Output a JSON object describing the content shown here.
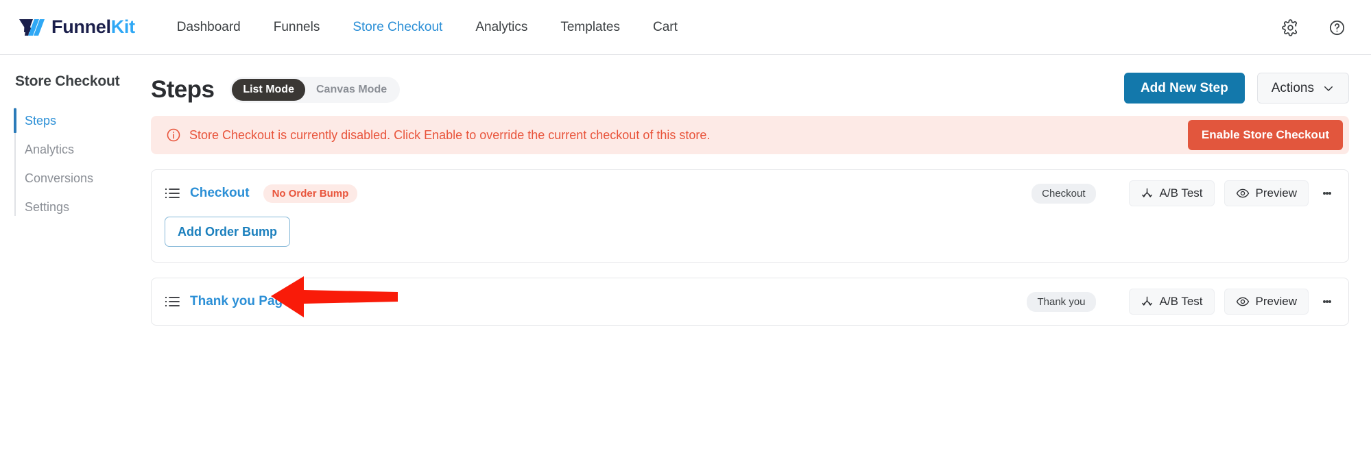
{
  "brand": {
    "name_dark": "Funnel",
    "name_light": "Kit",
    "logo_icon": "funnelkit-logo-icon"
  },
  "topnav": {
    "items": [
      {
        "label": "Dashboard",
        "active": false
      },
      {
        "label": "Funnels",
        "active": false
      },
      {
        "label": "Store Checkout",
        "active": true
      },
      {
        "label": "Analytics",
        "active": false
      },
      {
        "label": "Templates",
        "active": false
      },
      {
        "label": "Cart",
        "active": false
      }
    ],
    "settings_icon": "gear-icon",
    "help_icon": "help-circle-icon"
  },
  "sidebar": {
    "title": "Store Checkout",
    "items": [
      {
        "label": "Steps",
        "active": true
      },
      {
        "label": "Analytics",
        "active": false
      },
      {
        "label": "Conversions",
        "active": false
      },
      {
        "label": "Settings",
        "active": false
      }
    ]
  },
  "page": {
    "title": "Steps",
    "mode_toggle": {
      "list_label": "List Mode",
      "canvas_label": "Canvas Mode",
      "selected": "List Mode"
    },
    "add_new_step_label": "Add New Step",
    "actions_label": "Actions"
  },
  "alert": {
    "icon": "info-circle-icon",
    "message": "Store Checkout is currently disabled. Click Enable to override the current checkout of this store.",
    "button_label": "Enable Store Checkout"
  },
  "steps": [
    {
      "icon": "list-icon",
      "name": "Checkout",
      "warning_badge": "No Order Bump",
      "type_badge": "Checkout",
      "ab_test_label": "A/B Test",
      "preview_label": "Preview",
      "menu_icon": "kebab-menu-icon",
      "sub_action_label": "Add Order Bump"
    },
    {
      "icon": "list-icon",
      "name": "Thank you Page",
      "warning_badge": "",
      "type_badge": "Thank you",
      "ab_test_label": "A/B Test",
      "preview_label": "Preview",
      "menu_icon": "kebab-menu-icon",
      "sub_action_label": ""
    }
  ],
  "annotation": {
    "shape": "red-arrow-pointing-left",
    "color": "#f91b09"
  },
  "colors": {
    "brand_dark": "#1b1f4b",
    "brand_light": "#2fa8f5",
    "accent_blue": "#2b8fd6",
    "primary_button": "#1378ab",
    "alert_bg": "#fdeae6",
    "alert_text": "#e8533a",
    "alert_button": "#e2563d",
    "toggle_active": "#3a3734"
  }
}
